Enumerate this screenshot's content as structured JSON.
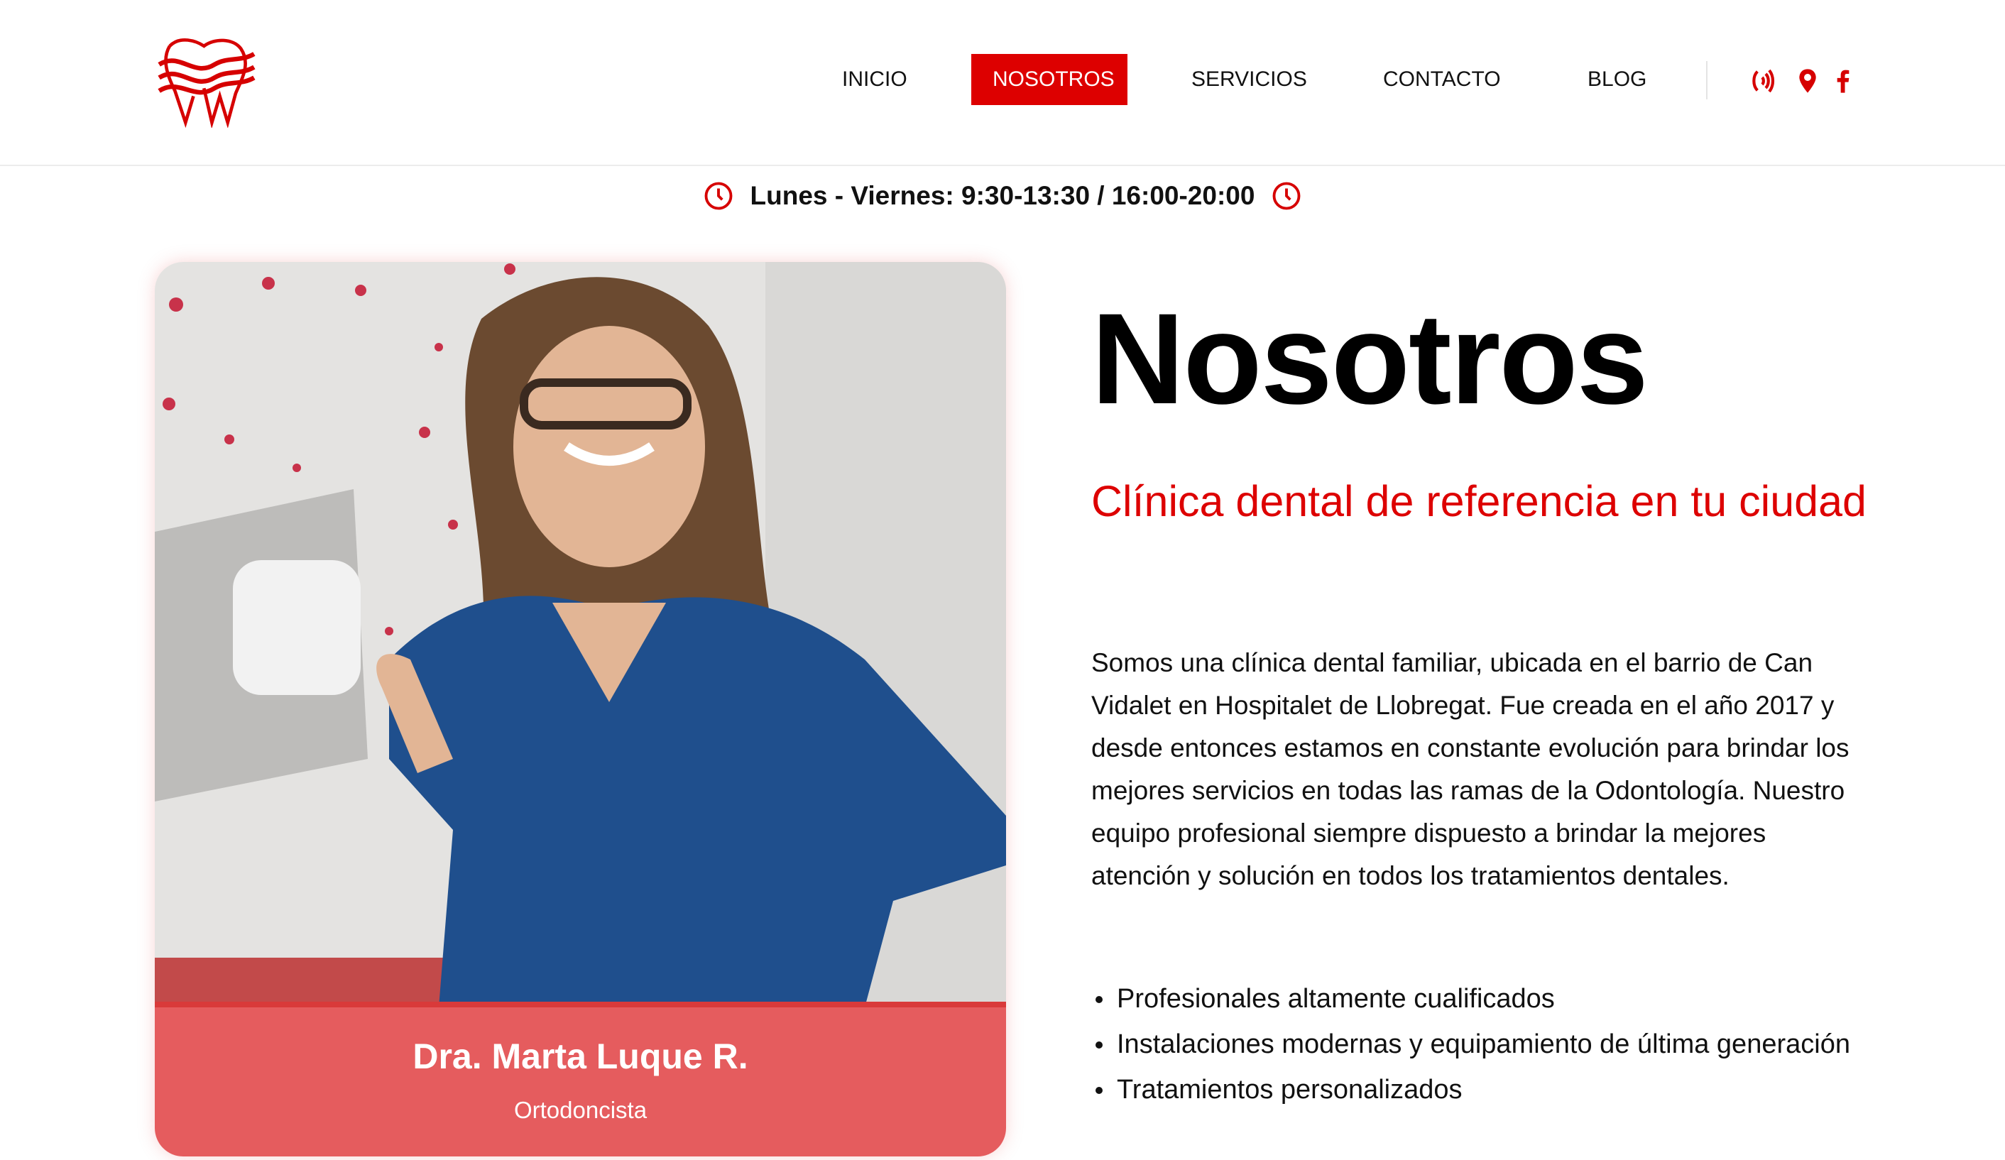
{
  "nav": {
    "items": [
      {
        "label": "INICIO"
      },
      {
        "label": "NOSOTROS",
        "active": true
      },
      {
        "label": "SERVICIOS"
      },
      {
        "label": "CONTACTO"
      },
      {
        "label": "BLOG"
      }
    ],
    "icons": [
      "phone-icon",
      "location-icon",
      "facebook-icon"
    ]
  },
  "hours": {
    "text": "Lunes - Viernes: 9:30-13:30 / 16:00-20:00"
  },
  "card": {
    "name": "Dra. Marta Luque R.",
    "role": "Ortodoncista"
  },
  "main": {
    "title": "Nosotros",
    "subtitle": "Clínica dental de referencia en tu ciudad",
    "paragraph": "Somos una clínica dental familiar, ubicada en el barrio de Can Vidalet en Hospitalet de Llobregat. Fue creada en el año 2017 y desde entonces estamos en constante evolución para brindar los mejores servicios en todas las ramas de la Odontología. Nuestro equipo profesional siempre dispuesto a brindar la mejores atención y solución en todos los tratamientos dentales.",
    "bullets": [
      "Profesionales altamente cualificados",
      "Instalaciones modernas y equipamiento de última generación",
      "Tratamientos personalizados"
    ]
  },
  "colors": {
    "brand": "#dd0000",
    "caption": "#e55c5e"
  }
}
